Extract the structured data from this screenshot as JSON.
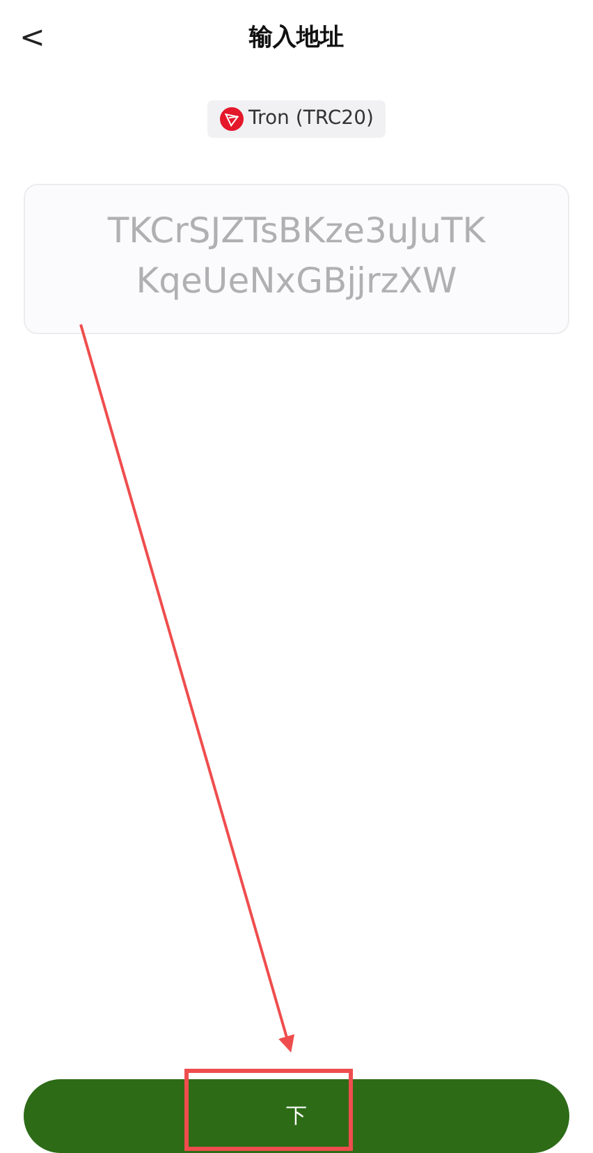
{
  "header": {
    "back": "<",
    "title": "输入地址"
  },
  "network": {
    "label": "Tron (TRC20)"
  },
  "address_field": {
    "placeholder": "TKCrSJZTsBKze3uJuTK KqeUeNxGBjjrzXW"
  },
  "next_button": {
    "label": "下"
  }
}
